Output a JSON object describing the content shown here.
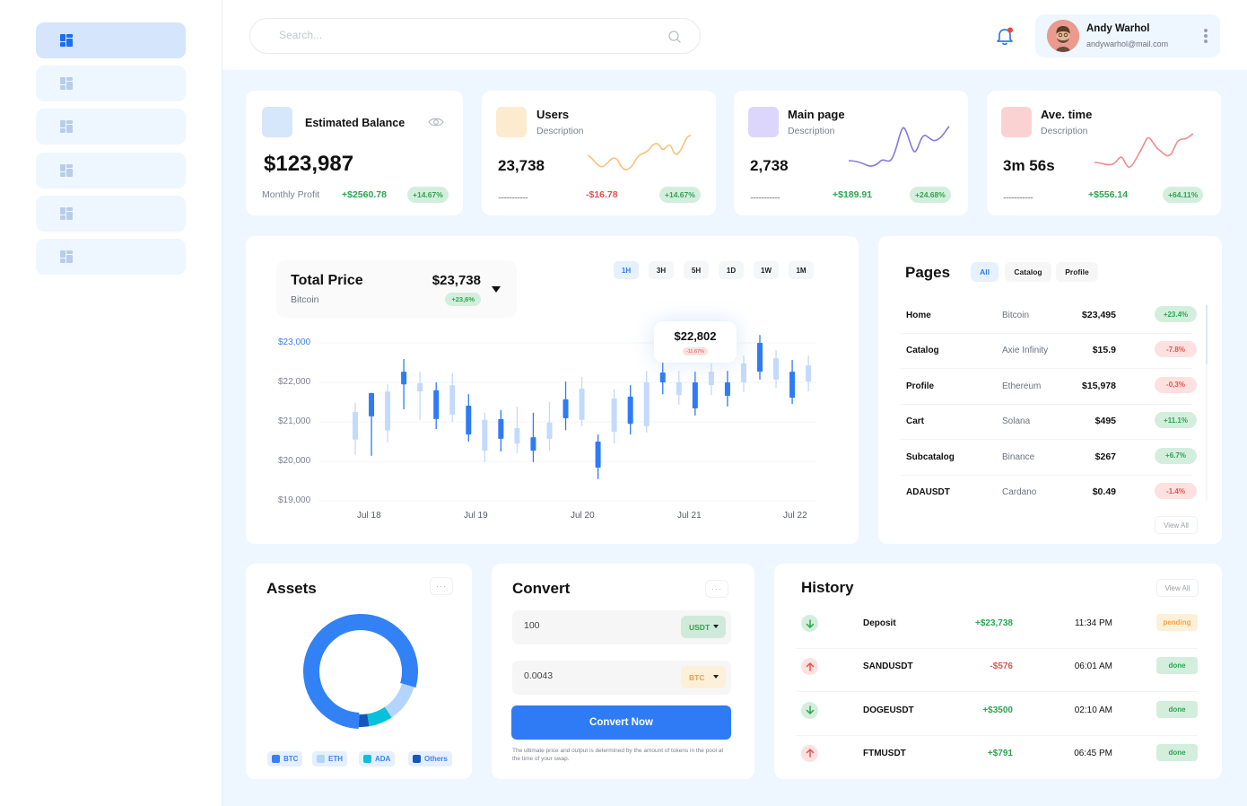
{
  "sidebar": {
    "items": [
      {
        "icon": "dashboard-icon",
        "active": true
      },
      {
        "icon": "dashboard-icon",
        "active": false
      },
      {
        "icon": "dashboard-icon",
        "active": false
      },
      {
        "icon": "dashboard-icon",
        "active": false
      },
      {
        "icon": "dashboard-icon",
        "active": false
      },
      {
        "icon": "dashboard-icon",
        "active": false
      }
    ]
  },
  "header": {
    "search_placeholder": "Search...",
    "notification_icon": "bell-icon",
    "user": {
      "name": "Andy Warhol",
      "email": "andywarhol@mail.com"
    }
  },
  "stats": {
    "balance": {
      "title": "Estimated Balance",
      "value": "$123,987",
      "label": "Monthly Profit",
      "change": "+$2560.78",
      "badge": "+14.67%",
      "color": "#d6e6fb"
    },
    "users": {
      "title": "Users",
      "desc": "Description",
      "value": "23,738",
      "dots": "......................",
      "change": "-$16.78",
      "badge": "+14.67%",
      "color": "#fdebd0",
      "line_color": "#f7c27a"
    },
    "main_page": {
      "title": "Main page",
      "desc": "Description",
      "value": "2,738",
      "dots": "......................",
      "change": "+$189.91",
      "badge": "+24.68%",
      "color": "#dcd6fb",
      "line_color": "#8877e0"
    },
    "ave_time": {
      "title": "Ave. time",
      "desc": "Description",
      "value": "3m 56s",
      "dots": "......................",
      "change": "+$556.14",
      "badge": "+64.11%",
      "color": "#fbd2d2",
      "line_color": "#f08c8c"
    }
  },
  "price_chart": {
    "title": "Total Price",
    "subtitle": "Bitcoin",
    "value": "$23,738",
    "badge": "+23,6%",
    "timeframes": [
      "1H",
      "3H",
      "5H",
      "1D",
      "1W",
      "1M"
    ],
    "active_timeframe": "1H",
    "tooltip": {
      "value": "$22,802",
      "badge": "-11,67%"
    }
  },
  "chart_data": {
    "type": "candlestick",
    "title": "Total Price",
    "ylim": [
      19000,
      23000
    ],
    "yticks": [
      "$23,000",
      "$22,000",
      "$21,000",
      "$20,000",
      "$19,000"
    ],
    "ytick_values": [
      23000,
      22000,
      21000,
      20000,
      19000
    ],
    "xticks": [
      "Jul 18",
      "Jul 19",
      "Jul 20",
      "Jul 21",
      "Jul 22"
    ],
    "grid": true,
    "candles": [
      {
        "open": 20550,
        "close": 21250,
        "high": 21480,
        "low": 20160,
        "style": "light"
      },
      {
        "open": 21140,
        "close": 21730,
        "high": 21730,
        "low": 20140,
        "style": "dark"
      },
      {
        "open": 20780,
        "close": 21770,
        "high": 21950,
        "low": 20480,
        "style": "light"
      },
      {
        "open": 21950,
        "close": 22270,
        "high": 22590,
        "low": 21320,
        "style": "dark"
      },
      {
        "open": 21770,
        "close": 21980,
        "high": 22270,
        "low": 21050,
        "style": "light"
      },
      {
        "open": 21070,
        "close": 21800,
        "high": 22000,
        "low": 20820,
        "style": "dark"
      },
      {
        "open": 21180,
        "close": 21930,
        "high": 22230,
        "low": 21000,
        "style": "light"
      },
      {
        "open": 20680,
        "close": 21410,
        "high": 21700,
        "low": 20500,
        "style": "dark"
      },
      {
        "open": 20270,
        "close": 21050,
        "high": 21230,
        "low": 19980,
        "style": "light"
      },
      {
        "open": 20570,
        "close": 21070,
        "high": 21300,
        "low": 20250,
        "style": "dark"
      },
      {
        "open": 20450,
        "close": 20840,
        "high": 21390,
        "low": 20200,
        "style": "light"
      },
      {
        "open": 20270,
        "close": 20610,
        "high": 21230,
        "low": 19980,
        "style": "dark"
      },
      {
        "open": 20570,
        "close": 20980,
        "high": 21500,
        "low": 20270,
        "style": "light"
      },
      {
        "open": 21090,
        "close": 21570,
        "high": 22020,
        "low": 20790,
        "style": "dark"
      },
      {
        "open": 21050,
        "close": 21840,
        "high": 22140,
        "low": 20890,
        "style": "light"
      },
      {
        "open": 19840,
        "close": 20500,
        "high": 20680,
        "low": 19550,
        "style": "dark"
      },
      {
        "open": 20750,
        "close": 21590,
        "high": 21820,
        "low": 20450,
        "style": "light"
      },
      {
        "open": 20950,
        "close": 21640,
        "high": 21930,
        "low": 20680,
        "style": "dark"
      },
      {
        "open": 20890,
        "close": 22000,
        "high": 22290,
        "low": 20730,
        "style": "light"
      },
      {
        "op/en": 0,
        "open": 22000,
        "close": 22250,
        "high": 22520,
        "low": 21700,
        "style": "dark"
      },
      {
        "open": 21680,
        "close": 22000,
        "high": 22290,
        "low": 21430,
        "style": "light"
      },
      {
        "open": 21340,
        "close": 22000,
        "high": 22270,
        "low": 21160,
        "style": "dark"
      },
      {
        "open": 21930,
        "close": 22270,
        "high": 22480,
        "low": 21680,
        "style": "light"
      },
      {
        "open": 21660,
        "close": 22000,
        "high": 22290,
        "low": 21390,
        "style": "dark"
      },
      {
        "open": 22000,
        "close": 22480,
        "high": 22680,
        "low": 21750,
        "style": "light"
      },
      {
        "open": 22270,
        "close": 23000,
        "high": 23200,
        "low": 22070,
        "style": "dark"
      },
      {
        "open": 22070,
        "close": 22610,
        "high": 22820,
        "low": 21860,
        "style": "light"
      },
      {
        "open": 21610,
        "close": 22270,
        "high": 22570,
        "low": 21450,
        "style": "dark"
      },
      {
        "open": 22020,
        "close": 22430,
        "high": 22680,
        "low": 21770,
        "style": "light"
      }
    ]
  },
  "pages": {
    "title": "Pages",
    "tabs": [
      "All",
      "Catalog",
      "Profile"
    ],
    "active_tab": "All",
    "rows": [
      {
        "page": "Home",
        "coin": "Bitcoin",
        "price": "$23,495",
        "change": "+23.4%",
        "trend": "up"
      },
      {
        "page": "Catalog",
        "coin": "Axie Infinity",
        "price": "$15.9",
        "change": "-7.8%",
        "trend": "down"
      },
      {
        "page": "Profile",
        "coin": "Ethereum",
        "price": "$15,978",
        "change": "-0,3%",
        "trend": "down"
      },
      {
        "page": "Cart",
        "coin": "Solana",
        "price": "$495",
        "change": "+11.1%",
        "trend": "up"
      },
      {
        "page": "Subcatalog",
        "coin": "Binance",
        "price": "$267",
        "change": "+6.7%",
        "trend": "up"
      },
      {
        "page": "ADAUSDT",
        "coin": "Cardano",
        "price": "$0.49",
        "change": "-1.4%",
        "trend": "down"
      }
    ],
    "view_all": "View All"
  },
  "assets": {
    "title": "Assets",
    "more": "···",
    "legend": [
      {
        "label": "BTC",
        "color": "#3282f6",
        "share": 0.79
      },
      {
        "label": "ETH",
        "color": "#b3d4fd",
        "share": 0.11
      },
      {
        "label": "ADA",
        "color": "#06c1d9",
        "share": 0.07
      },
      {
        "label": "Others",
        "color": "#1557b8",
        "share": 0.03
      }
    ]
  },
  "convert": {
    "title": "Convert",
    "more": "···",
    "from": {
      "value": "100",
      "currency": "USDT"
    },
    "to": {
      "value": "0.0043",
      "currency": "BTC"
    },
    "button": "Convert Now",
    "note": "The ultimate price and output is determined by the amount of tokens in the pool at the time of your swap."
  },
  "history": {
    "title": "History",
    "view_all": "View All",
    "rows": [
      {
        "direction": "down",
        "name": "Deposit",
        "amount": "+$23,738",
        "amount_sign": "pos",
        "time": "11:34 PM",
        "status": "pending"
      },
      {
        "direction": "up",
        "name": "SANDUSDT",
        "amount": "-$576",
        "amount_sign": "neg",
        "time": "06:01 AM",
        "status": "done"
      },
      {
        "direction": "down",
        "name": "DOGEUSDT",
        "amount": "+$3500",
        "amount_sign": "pos",
        "time": "02:10 AM",
        "status": "done"
      },
      {
        "direction": "up",
        "name": "FTMUSDT",
        "amount": "+$791",
        "amount_sign": "pos",
        "time": "06:45 PM",
        "status": "done"
      }
    ]
  }
}
